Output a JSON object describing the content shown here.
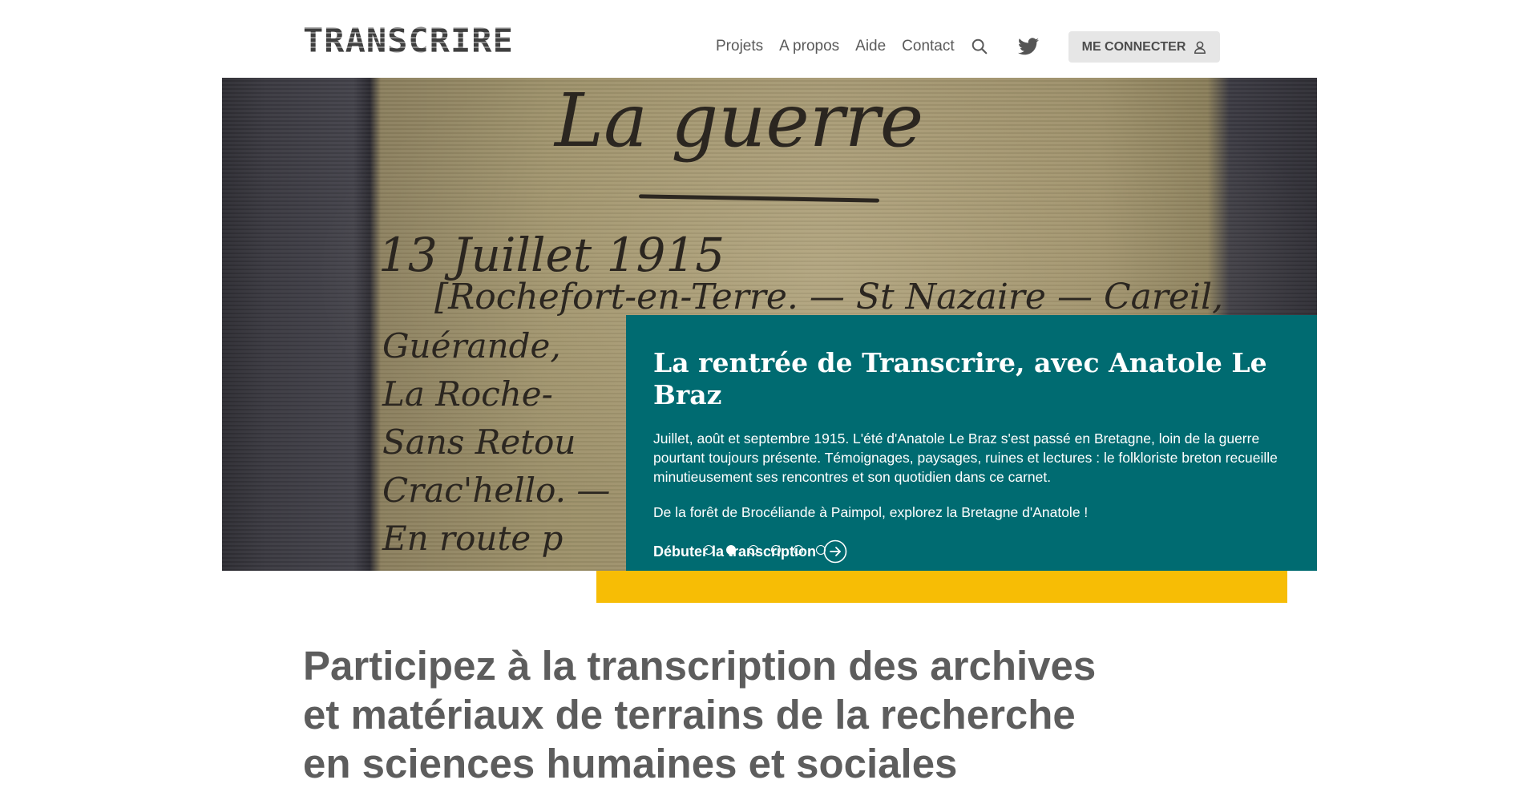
{
  "header": {
    "logo_text": "TRANSCRIRE",
    "nav": [
      "Projets",
      "A propos",
      "Aide",
      "Contact"
    ],
    "login_label": "ME CONNECTER"
  },
  "hero": {
    "handwriting": [
      "La guerre",
      "13 Juillet 1915",
      "[Rochefort-en-Terre. — St Nazaire — Careil,",
      "Guérande, ",
      "La Roche-",
      "Sans Retou",
      "Crac'hello. —",
      "En route p"
    ],
    "card": {
      "title": "La rentrée de Transcrire, avec Anatole Le Braz",
      "paragraph1": "Juillet, août et septembre 1915. L'été d'Anatole Le Braz s'est passé en Bretagne, loin de la guerre pourtant toujours présente. Témoignages, paysages, ruines et lectures : le folkloriste breton recueille minutieusement ses rencontres et son quotidien dans ce carnet.",
      "paragraph2": "De la forêt de Brocéliande à Paimpol, explorez la Bretagne d'Anatole !",
      "cta_label": "Débuter la transcription"
    },
    "carousel": {
      "slide_count": 6,
      "active_index": 1
    }
  },
  "main": {
    "headline": "Participez à la transcription des archives et matériaux de terrains de la recherche en sciences humaines et sociales"
  },
  "colors": {
    "teal": "#006b71",
    "yellow": "#f7bd05",
    "text_gray": "#5a5a5a",
    "button_bg": "#e6e6e6"
  },
  "icons": [
    "search-icon",
    "twitter-icon",
    "user-icon",
    "arrow-right-circle-icon"
  ]
}
